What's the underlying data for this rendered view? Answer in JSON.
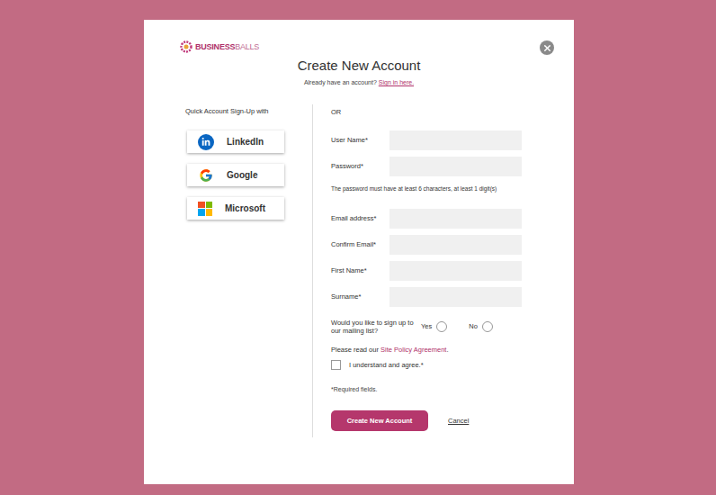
{
  "logo": {
    "bold": "BUSINESS",
    "light": "BALLS"
  },
  "dialog": {
    "title": "Create New Account",
    "signin_prompt": "Already have an account? ",
    "signin_link": "Sign in here."
  },
  "social": {
    "heading": "Quick Account Sign-Up with",
    "buttons": [
      {
        "label": "LinkedIn",
        "kind": "linkedin"
      },
      {
        "label": "Google",
        "kind": "google"
      },
      {
        "label": "Microsoft",
        "kind": "microsoft"
      }
    ]
  },
  "form": {
    "separator": "OR",
    "fields": [
      {
        "label": "User Name*",
        "value": ""
      },
      {
        "label": "Password*",
        "value": "",
        "hint": "The password must have at least 6 characters, at least 1 digit(s)"
      },
      {
        "label": "Email address*",
        "value": ""
      },
      {
        "label": "Confirm Email*",
        "value": ""
      },
      {
        "label": "First Name*",
        "value": ""
      },
      {
        "label": "Surname*",
        "value": ""
      }
    ],
    "mailing": {
      "question": "Would you like to sign up to our mailing list?",
      "options": [
        {
          "label": "Yes",
          "selected": false
        },
        {
          "label": "No",
          "selected": false
        }
      ]
    },
    "policy": {
      "prefix": "Please read our ",
      "link": "Site Policy Agreement",
      "suffix": "."
    },
    "agree": {
      "label": "I understand and agree.*",
      "checked": false
    },
    "required_note": "*Required fields.",
    "submit": "Create New Account",
    "cancel": "Cancel"
  }
}
